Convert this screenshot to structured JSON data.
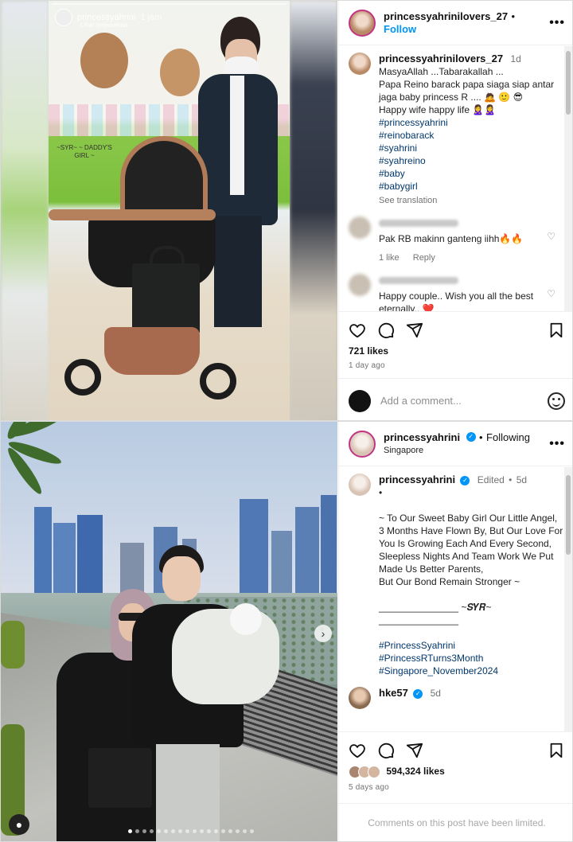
{
  "post1": {
    "story": {
      "username": "princessyahrini",
      "time": "1 jam",
      "translate_link": "Lihat terjemahan",
      "sticker_text": "~SYR~ ~ DADDY'S GIRL ~"
    },
    "header": {
      "username": "princessyahrinilovers_27",
      "separator": "•",
      "follow_label": "Follow"
    },
    "caption": {
      "username": "princessyahrinilovers_27",
      "time": "1d",
      "lines": [
        "MasyaAllah ...Tabarakallah ...",
        "Papa Reino barack papa siaga siap antar jaga baby princess R .... 🙇 🙂 😎",
        "Happy wife happy life 🙎‍♀️🙎‍♀️"
      ],
      "hashtags": [
        "#princessyahrini",
        "#reinobarack",
        "#syahrini",
        "#syahreino",
        "#baby",
        "#babygirl"
      ],
      "see_translation": "See translation"
    },
    "comments": [
      {
        "text": "Pak RB makinn ganteng iihh🔥🔥",
        "likes": "1 like",
        "reply": "Reply"
      },
      {
        "text": "Happy couple.. Wish you all the best eternally.. ❤️"
      }
    ],
    "likes": "721 likes",
    "date": "1 day ago",
    "add_comment_placeholder": "Add a comment..."
  },
  "post2": {
    "header": {
      "username": "princessyahrini",
      "separator": "•",
      "following_label": "Following",
      "location": "Singapore"
    },
    "caption": {
      "username": "princessyahrini",
      "edited": "Edited",
      "separator": "•",
      "time": "5d",
      "lines": [
        "•",
        "~ To Our Sweet Baby Girl Our Little Angel,",
        "3 Months Have Flown By, But Our Love For You Is Growing Each And Every Second,",
        "Sleepless Nights And Team Work We Put Made Us Better Parents,",
        "But Our Bond Remain Stronger ~",
        " ",
        "_______________ ~𝑺𝒀𝑹~",
        "_______________"
      ],
      "hashtags": [
        "#PrincessSyahrini",
        "#PrincessRTurns3Month",
        "#Singapore_November2024"
      ]
    },
    "next_comment": {
      "username": "hke57",
      "time": "5d"
    },
    "likes": "594,324 likes",
    "date": "5 days ago",
    "limited_text": "Comments on this post have been limited."
  },
  "icons": {
    "like": "heart-icon",
    "comment": "comment-icon",
    "share": "share-icon",
    "save": "bookmark-icon",
    "more": "more-icon",
    "verified": "verified-icon",
    "emoji": "emoji-icon",
    "next": "chevron-right-icon",
    "tag": "user-tag-icon"
  },
  "colors": {
    "link_blue": "#0095f6",
    "hashtag": "#00376b",
    "meta_gray": "#737373"
  }
}
